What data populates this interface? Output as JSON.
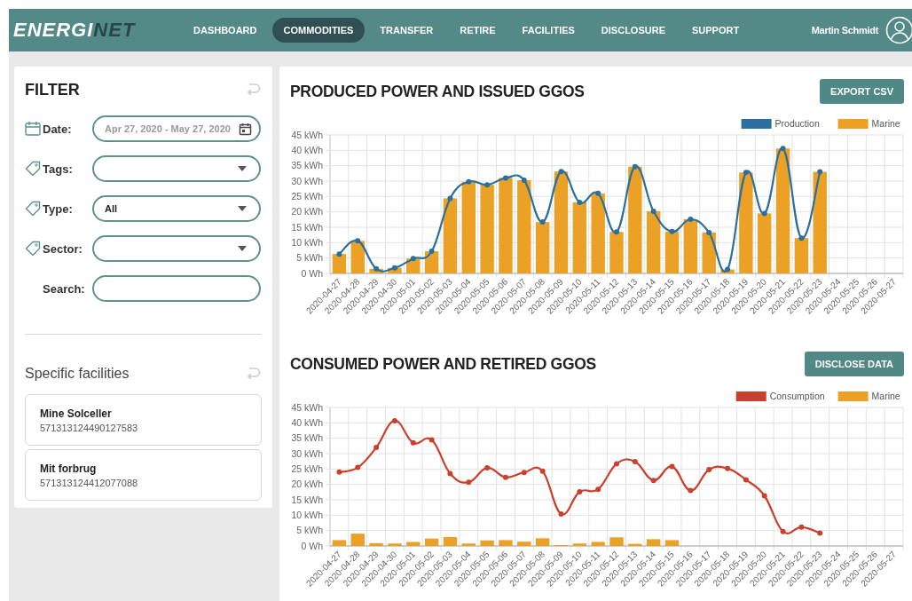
{
  "header": {
    "logo": {
      "lead": "ENERGI",
      "tail": "NET"
    },
    "nav": [
      {
        "label": "DASHBOARD",
        "selected": false
      },
      {
        "label": "COMMODITIES",
        "selected": true
      },
      {
        "label": "TRANSFER",
        "selected": false
      },
      {
        "label": "RETIRE",
        "selected": false
      },
      {
        "label": "FACILITIES",
        "selected": false
      },
      {
        "label": "DISCLOSURE",
        "selected": false
      },
      {
        "label": "SUPPORT",
        "selected": false
      }
    ],
    "user": "Martin Schmidt"
  },
  "filter": {
    "title": "FILTER",
    "fields": [
      {
        "kind": "date",
        "label": "Date:",
        "placeholder": "Apr 27, 2020 - May 27, 2020"
      },
      {
        "kind": "select",
        "label": "Tags:"
      },
      {
        "kind": "select",
        "label": "Type:",
        "value": "All"
      },
      {
        "kind": "select",
        "label": "Sector:"
      },
      {
        "kind": "text",
        "label": "Search:"
      }
    ],
    "facilities_title": "Specific facilities",
    "facilities": [
      {
        "name": "Mine Solceller",
        "id": "571313124490127583"
      },
      {
        "name": "Mit forbrug",
        "id": "571313124412077088"
      }
    ]
  },
  "charts": [
    {
      "title": "PRODUCED POWER AND ISSUED GGOS",
      "button": "EXPORT CSV",
      "chart_data": {
        "type": "bar",
        "grid": true,
        "legend": "top-right",
        "categories": [
          "2020-04-27",
          "2020-04-28",
          "2020-04-29",
          "2020-04-30",
          "2020-05-01",
          "2020-05-02",
          "2020-05-03",
          "2020-05-04",
          "2020-05-05",
          "2020-05-06",
          "2020-05-07",
          "2020-05-08",
          "2020-05-09",
          "2020-05-10",
          "2020-05-11",
          "2020-05-12",
          "2020-05-13",
          "2020-05-14",
          "2020-05-15",
          "2020-05-16",
          "2020-05-17",
          "2020-05-18",
          "2020-05-19",
          "2020-05-20",
          "2020-05-21",
          "2020-05-22",
          "2020-05-23",
          "2020-05-24",
          "2020-05-25",
          "2020-05-26",
          "2020-05-27"
        ],
        "ylim": [
          0,
          45
        ],
        "yticks": [
          {
            "value": 0,
            "label": "0 Wh"
          },
          {
            "value": 5,
            "label": "5 kWh"
          },
          {
            "value": 10,
            "label": "10 kWh"
          },
          {
            "value": 15,
            "label": "15 kWh"
          },
          {
            "value": 20,
            "label": "20 kWh"
          },
          {
            "value": 25,
            "label": "25 kWh"
          },
          {
            "value": 30,
            "label": "30 kWh"
          },
          {
            "value": 35,
            "label": "35 kWh"
          },
          {
            "value": 40,
            "label": "40 kWh"
          },
          {
            "value": 45,
            "label": "45 kWh"
          }
        ],
        "series": [
          {
            "name": "Production",
            "type": "line",
            "marker": "circle",
            "color": "#2a6f9e",
            "values": [
              6.3,
              10.6,
              1.5,
              1.8,
              4.8,
              7.2,
              24.4,
              29.8,
              28.8,
              31.0,
              30.3,
              16.7,
              33.1,
              23.1,
              26.0,
              13.5,
              34.7,
              20.2,
              13.6,
              17.6,
              13.3,
              1.3,
              32.8,
              19.5,
              40.6,
              11.5,
              33.0,
              null,
              null,
              null,
              null
            ]
          },
          {
            "name": "Marine",
            "type": "bar",
            "color": "#eba126",
            "values": [
              6.3,
              10.6,
              1.5,
              1.8,
              4.8,
              7.2,
              24.4,
              29.8,
              28.8,
              31.0,
              30.3,
              16.7,
              33.1,
              23.1,
              26.0,
              13.5,
              34.7,
              20.2,
              13.6,
              17.6,
              13.3,
              1.3,
              32.8,
              19.5,
              40.6,
              11.5,
              33.0,
              null,
              null,
              null,
              null
            ]
          }
        ]
      }
    },
    {
      "title": "CONSUMED POWER AND RETIRED GGOS",
      "button": "DISCLOSE DATA",
      "chart_data": {
        "type": "bar",
        "grid": true,
        "legend": "top-right",
        "categories": [
          "2020-04-27",
          "2020-04-28",
          "2020-04-29",
          "2020-04-30",
          "2020-05-01",
          "2020-05-02",
          "2020-05-03",
          "2020-05-04",
          "2020-05-05",
          "2020-05-06",
          "2020-05-07",
          "2020-05-08",
          "2020-05-09",
          "2020-05-10",
          "2020-05-11",
          "2020-05-12",
          "2020-05-13",
          "2020-05-14",
          "2020-05-15",
          "2020-05-16",
          "2020-05-17",
          "2020-05-18",
          "2020-05-19",
          "2020-05-20",
          "2020-05-21",
          "2020-05-22",
          "2020-05-23",
          "2020-05-24",
          "2020-05-25",
          "2020-05-26",
          "2020-05-27"
        ],
        "ylim": [
          0,
          45
        ],
        "yticks": [
          {
            "value": 0,
            "label": "0 Wh"
          },
          {
            "value": 5,
            "label": "5 kWh"
          },
          {
            "value": 10,
            "label": "10 kWh"
          },
          {
            "value": 15,
            "label": "15 kWh"
          },
          {
            "value": 20,
            "label": "20 kWh"
          },
          {
            "value": 25,
            "label": "25 kWh"
          },
          {
            "value": 30,
            "label": "30 kWh"
          },
          {
            "value": 35,
            "label": "35 kWh"
          },
          {
            "value": 40,
            "label": "40 kWh"
          },
          {
            "value": 45,
            "label": "45 kWh"
          }
        ],
        "series": [
          {
            "name": "Consumption",
            "type": "line",
            "marker": "circle",
            "color": "#c9402c",
            "values": [
              24.0,
              25.5,
              32.0,
              40.7,
              33.5,
              34.5,
              23.5,
              20.7,
              25.4,
              22.3,
              23.9,
              24.3,
              10.4,
              17.6,
              18.4,
              26.7,
              27.4,
              21.3,
              25.8,
              18.0,
              24.8,
              25.2,
              21.5,
              16.3,
              4.7,
              6.1,
              4.2,
              null,
              null,
              null,
              null
            ]
          },
          {
            "name": "Marine",
            "type": "bar",
            "color": "#eba126",
            "values": [
              1.9,
              4.0,
              0.9,
              0.8,
              1.3,
              2.4,
              2.9,
              0.8,
              1.8,
              1.9,
              1.4,
              2.5,
              0.3,
              0.8,
              1.3,
              2.8,
              0.7,
              2.2,
              1.9,
              null,
              null,
              null,
              null,
              null,
              null,
              null,
              null,
              null,
              null,
              null,
              null
            ]
          }
        ]
      }
    }
  ]
}
